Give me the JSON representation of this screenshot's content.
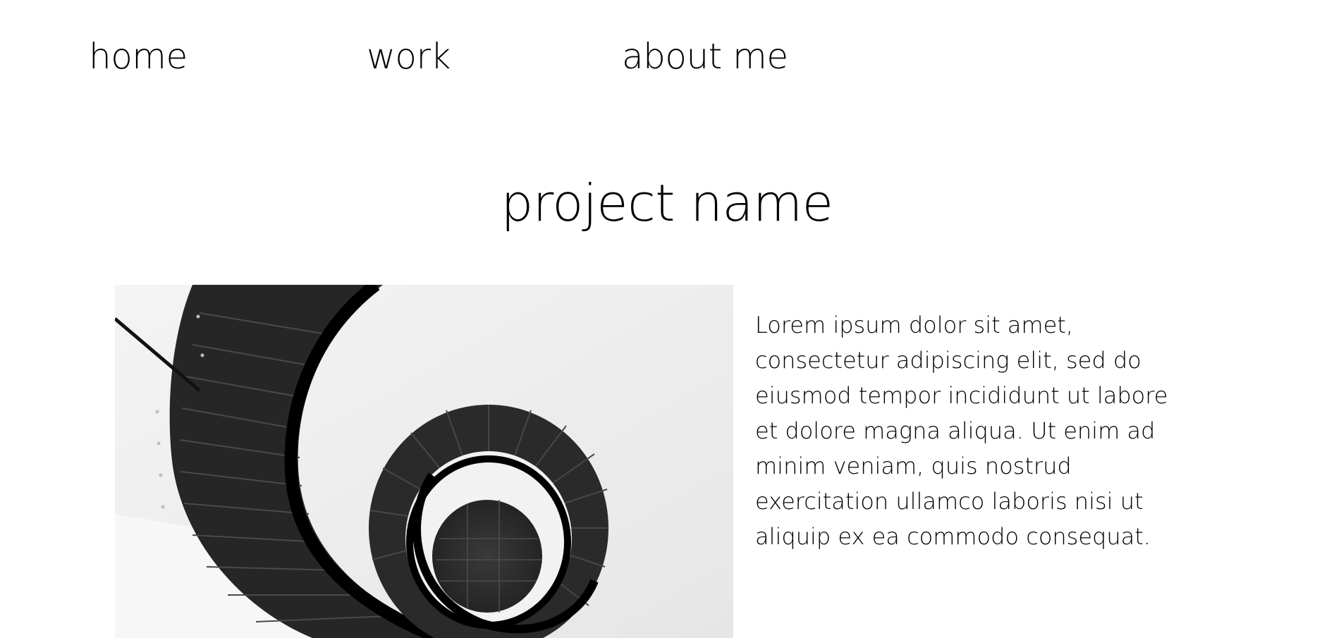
{
  "nav": {
    "items": [
      {
        "label": "home"
      },
      {
        "label": "work"
      },
      {
        "label": "about me"
      }
    ]
  },
  "project": {
    "title": "project name",
    "image_icon": "spiral-staircase-photo",
    "description": "Lorem ipsum dolor sit amet,\nconsectetur adipiscing elit, sed do\neiusmod tempor incididunt ut labore\net dolore magna aliqua. Ut enim ad\nminim veniam, quis nostrud\nexercitation ullamco laboris nisi ut\naliquip ex ea commodo consequat."
  },
  "colors": {
    "background": "#ffffff",
    "text": "#000000",
    "image_light": "#ededed",
    "image_dark": "#1a1a1a"
  }
}
